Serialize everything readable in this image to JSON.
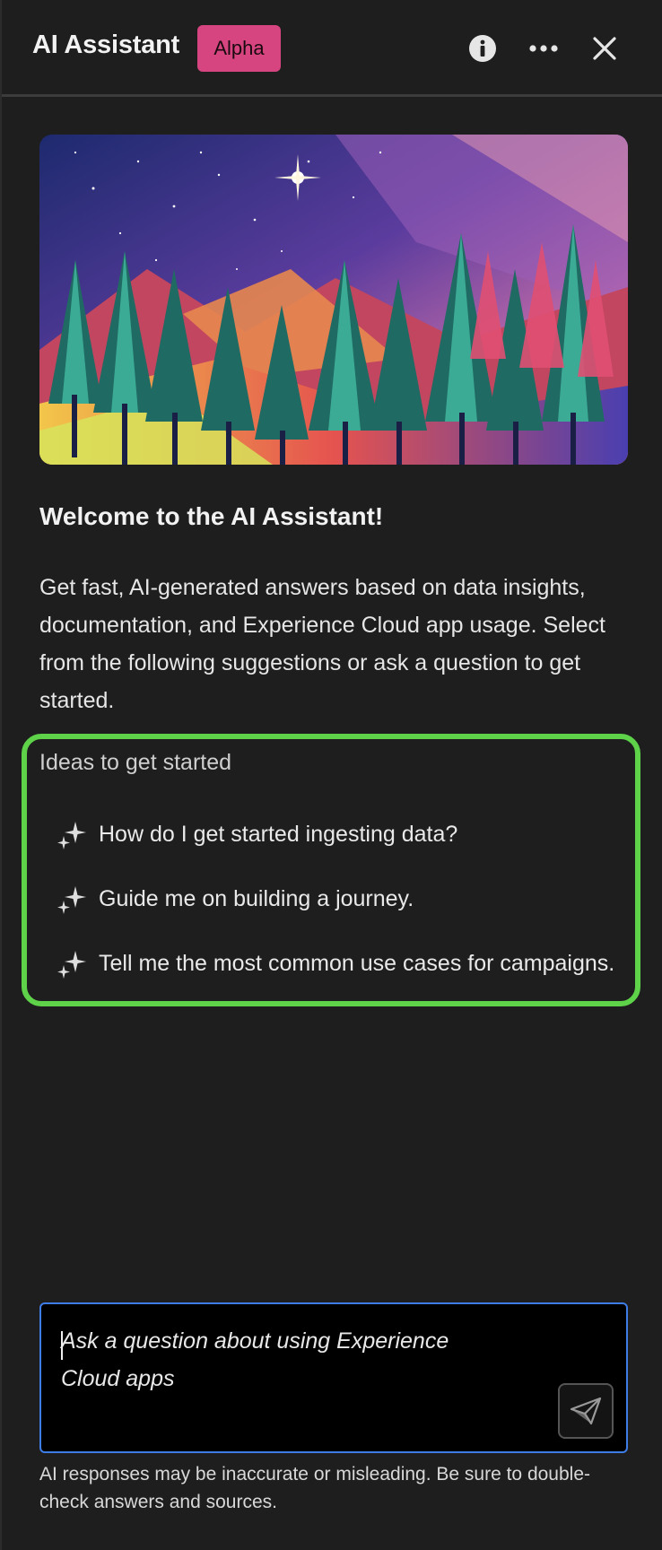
{
  "header": {
    "title": "AI Assistant",
    "badge": "Alpha",
    "icons": [
      "info-icon",
      "more-icon",
      "close-icon"
    ]
  },
  "hero": {
    "description": "low-poly illustration of a colorful pine forest under a starry sky"
  },
  "welcome": {
    "heading": "Welcome to the AI Assistant!",
    "body": "Get fast, AI-generated answers based on data insights, documentation, and Experience Cloud app usage. Select from the following suggestions or ask a question to get started."
  },
  "ideas": {
    "title": "Ideas to get started",
    "items": [
      {
        "label": "How do I get started ingesting data?",
        "icon": "sparkle-icon"
      },
      {
        "label": "Guide me on building a journey.",
        "icon": "sparkle-icon"
      },
      {
        "label": "Tell me the most common use cases for campaigns.",
        "icon": "sparkle-icon"
      }
    ],
    "highlight_color": "#5ed34a"
  },
  "input": {
    "placeholder": "Ask a question about using Experience Cloud apps",
    "value": "",
    "send_icon": "send-icon"
  },
  "disclaimer": "AI responses may be inaccurate or misleading. Be sure to double-check answers and sources.",
  "colors": {
    "background": "#1e1e1e",
    "badge": "#d6457f",
    "focus_border": "#3f7de6"
  }
}
